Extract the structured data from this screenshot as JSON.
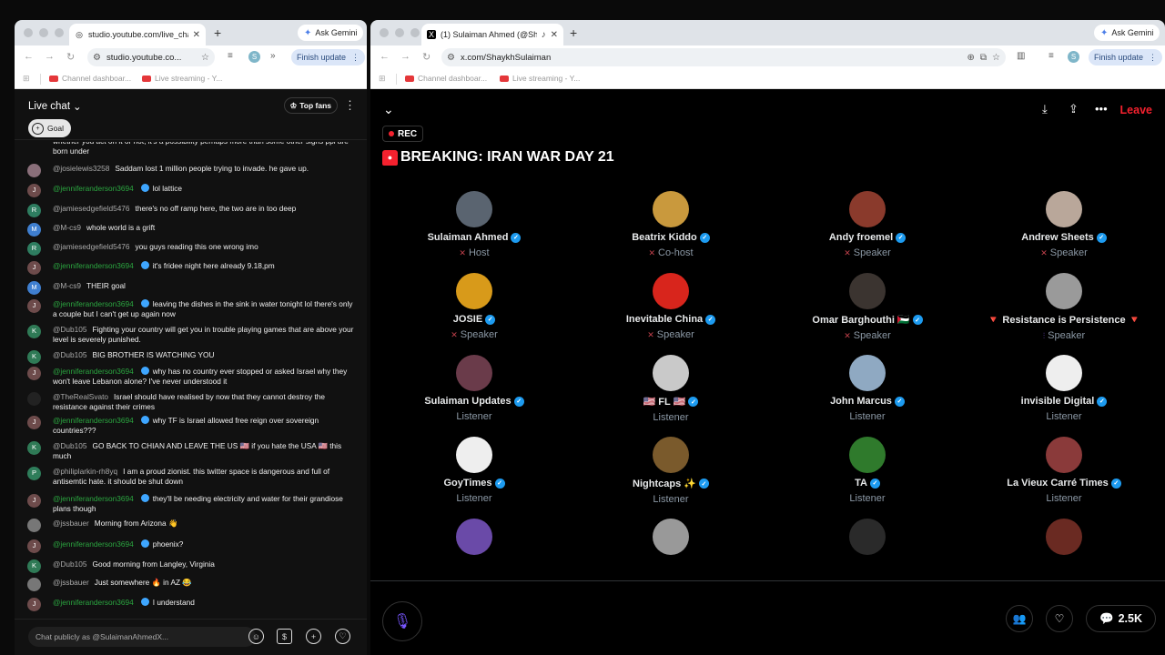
{
  "left_browser": {
    "tab_title": "studio.youtube.com/live_chat",
    "ask_gemini": "Ask Gemini",
    "url": "studio.youtube.co...",
    "profile_initial": "S",
    "finish_update": "Finish update",
    "bookmarks": [
      "Channel dashboar...",
      "Live streaming - Y..."
    ]
  },
  "right_browser": {
    "tab_title": "(1) Sulaiman Ahmed (@Sh",
    "ask_gemini": "Ask Gemini",
    "url": "x.com/ShaykhSulaiman",
    "profile_initial": "S",
    "finish_update": "Finish update",
    "bookmarks": [
      "Channel dashboar...",
      "Live streaming - Y..."
    ]
  },
  "chat": {
    "title": "Live chat",
    "top_fans": "Top fans",
    "goal": "Goal",
    "input_placeholder": "Chat publicly as @SulaimanAhmedX...",
    "messages": [
      {
        "author": "",
        "text": "whether you act on it or not, it's a possibility perhaps more than some other signs ppl are born under",
        "initial": "",
        "color": "#111111",
        "member": false
      },
      {
        "author": "@josielewis3258",
        "text": "Saddam lost 1 million people trying to invade. he gave up.",
        "initial": "",
        "color": "#8a6f7a",
        "member": false
      },
      {
        "author": "@jenniferanderson3694",
        "text": "lol lattice",
        "initial": "J",
        "color": "#6d4b4b",
        "member": true
      },
      {
        "author": "@jamiesedgefield5476",
        "text": "there's no off ramp here, the two are in too deep",
        "initial": "R",
        "color": "#2e7d60",
        "member": false
      },
      {
        "author": "@M-cs9",
        "text": "whole world is a grift",
        "initial": "M",
        "color": "#3f7fd0",
        "member": false
      },
      {
        "author": "@jamiesedgefield5476",
        "text": "you guys reading this one wrong imo",
        "initial": "R",
        "color": "#2e7d60",
        "member": false
      },
      {
        "author": "@jenniferanderson3694",
        "text": "it's fridee night here already 9.18,pm",
        "initial": "J",
        "color": "#6d4b4b",
        "member": true
      },
      {
        "author": "@M-cs9",
        "text": "THEIR goal",
        "initial": "M",
        "color": "#3f7fd0",
        "member": false
      },
      {
        "author": "@jenniferanderson3694",
        "text": "leaving the dishes in the sink in water tonight lol there's only a couple but I can't get up again now",
        "initial": "J",
        "color": "#6d4b4b",
        "member": true
      },
      {
        "author": "@Dub105",
        "text": "Fighting your country will get you in trouble playing games that are above your level is severely punished.",
        "initial": "K",
        "color": "#2f7a56",
        "member": false
      },
      {
        "author": "@Dub105",
        "text": "BIG BROTHER IS WATCHING YOU",
        "initial": "K",
        "color": "#2f7a56",
        "member": false
      },
      {
        "author": "@jenniferanderson3694",
        "text": "why has no country ever stopped or asked Israel why they won't leave Lebanon alone? I've never understood it",
        "initial": "J",
        "color": "#6d4b4b",
        "member": true
      },
      {
        "author": "@TheRealSvato",
        "text": "Israel should have realised by now that they cannot destroy the resistance against their crimes",
        "initial": "",
        "color": "#222222",
        "member": false
      },
      {
        "author": "@jenniferanderson3694",
        "text": "why TF is Israel allowed free reign over sovereign countries???",
        "initial": "J",
        "color": "#6d4b4b",
        "member": true
      },
      {
        "author": "@Dub105",
        "text": "GO BACK TO CHIAN AND LEAVE THE US 🇺🇸 if you hate the USA 🇺🇸 this much",
        "initial": "K",
        "color": "#2f7a56",
        "member": false
      },
      {
        "author": "@philiplarkin-rh8yq",
        "text": "I am a proud zionist. this twitter space is dangerous and full of antisemtic hate. it should be shut down",
        "initial": "P",
        "color": "#2e7d5a",
        "member": false
      },
      {
        "author": "@jenniferanderson3694",
        "text": "they'll be needing electricity and water for their grandiose plans though",
        "initial": "J",
        "color": "#6d4b4b",
        "member": true
      },
      {
        "author": "@jssbauer",
        "text": "Morning from Arizona 👋",
        "initial": "",
        "color": "#777777",
        "member": false
      },
      {
        "author": "@jenniferanderson3694",
        "text": "phoenix?",
        "initial": "J",
        "color": "#6d4b4b",
        "member": true
      },
      {
        "author": "@Dub105",
        "text": "Good morning from Langley, Virginia",
        "initial": "K",
        "color": "#2f7a56",
        "member": false
      },
      {
        "author": "@jssbauer",
        "text": "Just somewhere 🔥 in AZ 😂",
        "initial": "",
        "color": "#777777",
        "member": false
      },
      {
        "author": "@jenniferanderson3694",
        "text": "I understand",
        "initial": "J",
        "color": "#6d4b4b",
        "member": true
      }
    ]
  },
  "space": {
    "rec": "REC",
    "title": "BREAKING: IRAN WAR DAY 21",
    "leave": "Leave",
    "replies_count": "2.5K",
    "participants": [
      {
        "name": "Sulaiman Ahmed",
        "role": "Host",
        "verified": true,
        "avatar": "#5a6470",
        "prefix": "",
        "suffix": ""
      },
      {
        "name": "Beatrix Kiddo",
        "role": "Co-host",
        "verified": true,
        "avatar": "#c9993d",
        "prefix": "",
        "suffix": ""
      },
      {
        "name": "Andy froemel",
        "role": "Speaker",
        "verified": true,
        "avatar": "#8a3a2c",
        "prefix": "",
        "suffix": ""
      },
      {
        "name": "Andrew Sheets",
        "role": "Speaker",
        "verified": true,
        "avatar": "#b9a79a",
        "prefix": "",
        "suffix": ""
      },
      {
        "name": "JOSIE",
        "role": "Speaker",
        "verified": true,
        "avatar": "#d89a1a",
        "prefix": "",
        "suffix": ""
      },
      {
        "name": "Inevitable China",
        "role": "Speaker",
        "verified": true,
        "avatar": "#d8251c",
        "prefix": "",
        "suffix": ""
      },
      {
        "name": "Omar Barghouthi",
        "role": "Speaker",
        "verified": true,
        "avatar": "#3b3430",
        "prefix": "",
        "suffix": "🇵🇸"
      },
      {
        "name": "Resistance is Persistence",
        "role": "Speaker",
        "verified": false,
        "avatar": "#9a9a9a",
        "prefix": "🔻",
        "suffix": "🔻"
      },
      {
        "name": "Sulaiman Updates",
        "role": "Listener",
        "verified": true,
        "avatar": "#6a3b4a",
        "prefix": "",
        "suffix": ""
      },
      {
        "name": "FL",
        "role": "Listener",
        "verified": true,
        "avatar": "#c9c9c9",
        "prefix": "🇺🇸",
        "suffix": "🇺🇸"
      },
      {
        "name": "John Marcus",
        "role": "Listener",
        "verified": true,
        "avatar": "#8fa9c2",
        "prefix": "",
        "suffix": ""
      },
      {
        "name": "invisible Digital",
        "role": "Listener",
        "verified": true,
        "avatar": "#eeeeee",
        "prefix": "",
        "suffix": ""
      },
      {
        "name": "GoyTimes",
        "role": "Listener",
        "verified": true,
        "avatar": "#eeeeee",
        "prefix": "",
        "suffix": ""
      },
      {
        "name": "Nightcaps",
        "role": "Listener",
        "verified": true,
        "avatar": "#7a5a2c",
        "prefix": "",
        "suffix": "✨"
      },
      {
        "name": "TA",
        "role": "Listener",
        "verified": true,
        "avatar": "#2f7a2c",
        "prefix": "",
        "suffix": ""
      },
      {
        "name": "La Vieux Carré Times",
        "role": "Listener",
        "verified": true,
        "avatar": "#8a3a3a",
        "prefix": "",
        "suffix": ""
      },
      {
        "name": "",
        "role": "",
        "verified": false,
        "avatar": "#6a4aa8",
        "prefix": "",
        "suffix": ""
      },
      {
        "name": "",
        "role": "",
        "verified": false,
        "avatar": "#999999",
        "prefix": "",
        "suffix": ""
      },
      {
        "name": "",
        "role": "",
        "verified": false,
        "avatar": "#2a2a2a",
        "prefix": "",
        "suffix": ""
      },
      {
        "name": "",
        "role": "",
        "verified": false,
        "avatar": "#6a2a22",
        "prefix": "",
        "suffix": ""
      }
    ]
  }
}
